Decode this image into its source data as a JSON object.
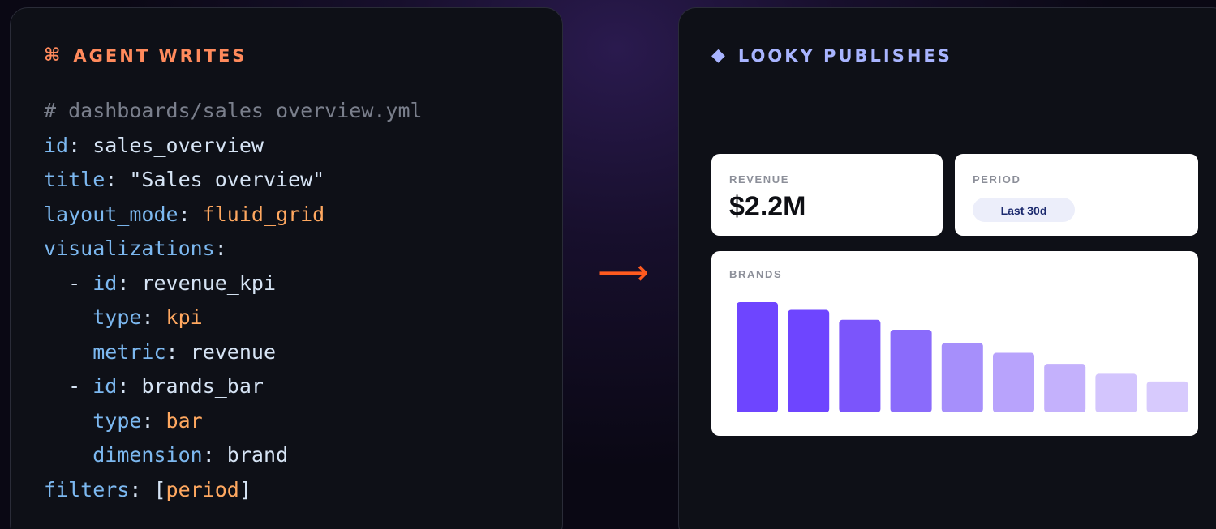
{
  "left": {
    "header_icon": "⌘",
    "header_icon_name": "command-icon",
    "title": "AGENT WRITES",
    "code_lines": [
      [
        {
          "t": "# dashboards/sales_overview.yml",
          "c": "comment"
        }
      ],
      [
        {
          "t": "id",
          "c": "key"
        },
        {
          "t": ": ",
          "c": "punct"
        },
        {
          "t": "sales_overview",
          "c": "str"
        }
      ],
      [
        {
          "t": "title",
          "c": "key"
        },
        {
          "t": ": ",
          "c": "punct"
        },
        {
          "t": "\"Sales overview\"",
          "c": "str"
        }
      ],
      [
        {
          "t": "layout_mode",
          "c": "key"
        },
        {
          "t": ": ",
          "c": "punct"
        },
        {
          "t": "fluid_grid",
          "c": "val"
        }
      ],
      [
        {
          "t": "visualizations",
          "c": "key"
        },
        {
          "t": ":",
          "c": "punct"
        }
      ],
      [
        {
          "t": "  - ",
          "c": "punct"
        },
        {
          "t": "id",
          "c": "key"
        },
        {
          "t": ": ",
          "c": "punct"
        },
        {
          "t": "revenue_kpi",
          "c": "str"
        }
      ],
      [
        {
          "t": "    ",
          "c": "punct"
        },
        {
          "t": "type",
          "c": "key"
        },
        {
          "t": ": ",
          "c": "punct"
        },
        {
          "t": "kpi",
          "c": "val"
        }
      ],
      [
        {
          "t": "    ",
          "c": "punct"
        },
        {
          "t": "metric",
          "c": "key"
        },
        {
          "t": ": ",
          "c": "punct"
        },
        {
          "t": "revenue",
          "c": "str"
        }
      ],
      [
        {
          "t": "  - ",
          "c": "punct"
        },
        {
          "t": "id",
          "c": "key"
        },
        {
          "t": ": ",
          "c": "punct"
        },
        {
          "t": "brands_bar",
          "c": "str"
        }
      ],
      [
        {
          "t": "    ",
          "c": "punct"
        },
        {
          "t": "type",
          "c": "key"
        },
        {
          "t": ": ",
          "c": "punct"
        },
        {
          "t": "bar",
          "c": "val"
        }
      ],
      [
        {
          "t": "    ",
          "c": "punct"
        },
        {
          "t": "dimension",
          "c": "key"
        },
        {
          "t": ": ",
          "c": "punct"
        },
        {
          "t": "brand",
          "c": "str"
        }
      ],
      [
        {
          "t": "filters",
          "c": "key"
        },
        {
          "t": ": [",
          "c": "punct"
        },
        {
          "t": "period",
          "c": "val"
        },
        {
          "t": "]",
          "c": "punct"
        }
      ]
    ]
  },
  "arrow": "⟶",
  "right": {
    "header_icon": "◆",
    "header_icon_name": "diamond-icon",
    "title": "LOOKY PUBLISHES",
    "revenue_card": {
      "label": "REVENUE",
      "value": "$2.2M"
    },
    "period_card": {
      "label": "PERIOD",
      "pill": "Last 30d"
    },
    "brands_card": {
      "label": "BRANDS"
    }
  },
  "chart_data": {
    "type": "bar",
    "values": [
      100,
      93,
      84,
      75,
      63,
      54,
      44,
      35,
      28
    ],
    "colors": [
      "#6e45ff",
      "#6e45ff",
      "#7b55fb",
      "#8a6bfb",
      "#a68ffb",
      "#b8a3fc",
      "#c4b1fc",
      "#d3c5fd",
      "#d7cafd"
    ]
  }
}
